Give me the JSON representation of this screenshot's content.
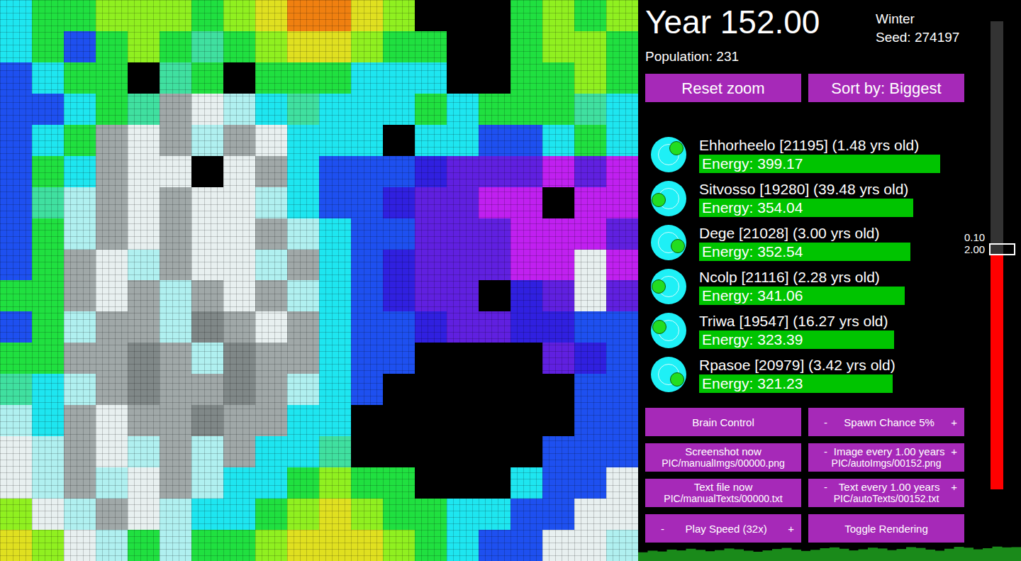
{
  "map": {
    "palette": {
      "K": "#000000",
      "B": "#1e50f0",
      "C": "#1ee6f0",
      "G": "#20e040",
      "L": "#90f020",
      "Y": "#e0e020",
      "O": "#f08010",
      "W": "#e8f0f0",
      "S": "#a0a8a8",
      "D": "#808888",
      "A": "#b0f0f0",
      "P": "#6020e0",
      "M": "#c020f0",
      "V": "#3020e0",
      "N": "#40e0a0"
    },
    "tiles": [
      "CGGLLLGLYOOYLKKKGLGL",
      "CGBGLGNGLYYLGGKKGLLG",
      "BCGGKNGKGGGCCCKKGGLG",
      "BBCGNSWACNCCCGCGGGNC",
      "BCGSWSASWCCCKCCBBCGC",
      "BGCSWWKWSCBBBVPPPMPM",
      "BNASWSWWACBBVPPMMKMM",
      "BGASWSWWSACBBPPPMMMP",
      "BGSWASWWASCBVPPPMMWM",
      "GGSWSASWSACBVPPKVPWP",
      "BGASSADSWSCBBVPPVVBB",
      "GGSSDSADSSCBBKKKKPVB",
      "NCASDSSDSACBKKKKKKBB",
      "ACSWSSDSSCCKKKKKKKBB",
      "WASWASASCCNKKKKKKBBB",
      "WASAWSACCGLGGKKKCBBW",
      "LWASWACCGLYLGGCCBBWW",
      "YLWAGAGGLYYYLGCBBWWA"
    ]
  },
  "header": {
    "year": "Year 152.00",
    "season": "Winter",
    "seed": "Seed: 274197",
    "population": "Population: 231"
  },
  "top_buttons": [
    "Reset zoom",
    "Sort by: Biggest"
  ],
  "creatures": [
    {
      "name": "Ehhorheelo [21195] (1.48 yrs old)",
      "energy": "Energy: 399.17",
      "level": 0.986,
      "angle": -40
    },
    {
      "name": "Sitvosso [19280] (39.48 yrs old)",
      "energy": "Energy: 354.04",
      "level": 0.875,
      "angle": 170
    },
    {
      "name": "Dege [21028] (3.00 yrs old)",
      "energy": "Energy: 352.54",
      "level": 0.864,
      "angle": 20
    },
    {
      "name": "Ncolp [21116] (2.28 yrs old)",
      "energy": "Energy: 341.06",
      "level": 0.84,
      "angle": 180
    },
    {
      "name": "Triwa [19547] (16.27 yrs old)",
      "energy": "Energy: 323.39",
      "level": 0.797,
      "angle": 200
    },
    {
      "name": "Rpasoe [20979] (3.42 yrs old)",
      "energy": "Energy: 321.23",
      "level": 0.791,
      "angle": 30
    }
  ],
  "control_buttons": [
    {
      "label": "Brain Control"
    },
    {
      "label": "Spawn Chance 5%",
      "minus": "-",
      "plus": "+"
    },
    {
      "label": "Screenshot now",
      "sublabel": "PIC/manualImgs/00000.png"
    },
    {
      "label": "Image every 1.00 years",
      "minus": "-",
      "plus": "+",
      "sublabel": "PIC/autoImgs/00152.png"
    },
    {
      "label": "Text file now",
      "sublabel": "PIC/manualTexts/00000.txt"
    },
    {
      "label": "Text every 1.00 years",
      "minus": "-",
      "plus": "+",
      "sublabel": "PIC/autoTexts/00152.txt"
    },
    {
      "label": "Play Speed (32x)",
      "minus": "-",
      "plus": "+"
    },
    {
      "label": "Toggle Rendering"
    }
  ],
  "slider": {
    "level": 0.5,
    "labels": [
      "0.10",
      "2.00"
    ]
  },
  "population_graph": {
    "values": [
      212,
      218,
      215,
      222,
      219,
      225,
      221,
      216,
      220,
      226,
      223,
      218,
      214,
      219,
      224,
      228,
      222,
      217,
      221,
      227,
      230,
      225,
      219,
      223,
      229,
      226,
      220,
      224,
      231,
      228,
      222,
      218,
      225,
      232,
      229,
      223,
      227,
      233,
      230,
      231
    ]
  }
}
